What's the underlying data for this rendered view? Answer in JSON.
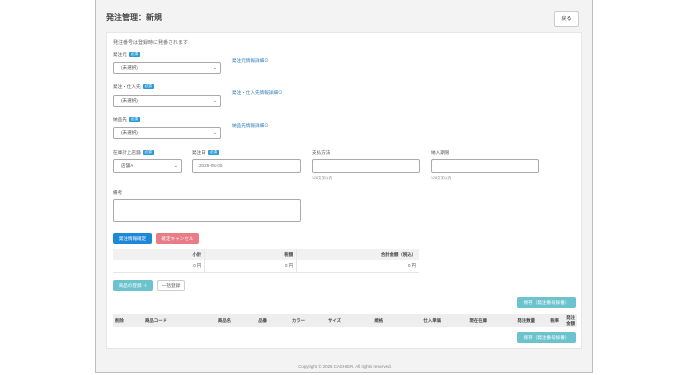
{
  "header": {
    "title": "発注管理：新規",
    "back_label": "戻る"
  },
  "form": {
    "note": "発注番号は登録時に発番されます",
    "required_badge": "必須",
    "supplier": {
      "label": "発注元",
      "value": "(未選択)",
      "link": "発注元情報詳細⊙"
    },
    "vendor": {
      "label": "発注・仕入先",
      "value": "(未選択)",
      "link": "発注・仕入先情報詳細⊙"
    },
    "delivery": {
      "label": "納品先",
      "value": "(未選択)",
      "link": "納品先情報詳細⊙"
    },
    "store": {
      "label": "在庫計上店舗",
      "value": "店舗A"
    },
    "order_date": {
      "label": "発注日",
      "value": "2025-05-05"
    },
    "payment": {
      "label": "支払方法",
      "value": "",
      "hint": "128文字以内"
    },
    "purchase_period": {
      "label": "納入期限",
      "value": "",
      "hint": "128文字以内"
    },
    "remarks": {
      "label": "備考",
      "value": ""
    }
  },
  "buttons": {
    "confirm": "発注情報確定",
    "cancel": "確定キャンセル",
    "add_product": "商品の登録 ＋",
    "bulk_register": "一括登録",
    "save_top": "保存（発注番号採番）",
    "save_bottom": "保存（発注番号採番）"
  },
  "summary": {
    "headers": [
      "小計",
      "税額",
      "合計金額（税込）"
    ],
    "values": [
      "0 円",
      "0 円",
      "0 円"
    ]
  },
  "items_table": {
    "headers": [
      "削除",
      "商品コード",
      "商品名",
      "品番",
      "カラー",
      "サイズ",
      "規格",
      "仕入単価",
      "現在在庫",
      "発注数量",
      "税率",
      "発注金額"
    ]
  },
  "footer": "Copyright © 2025 CASHIER. All rights reserved."
}
